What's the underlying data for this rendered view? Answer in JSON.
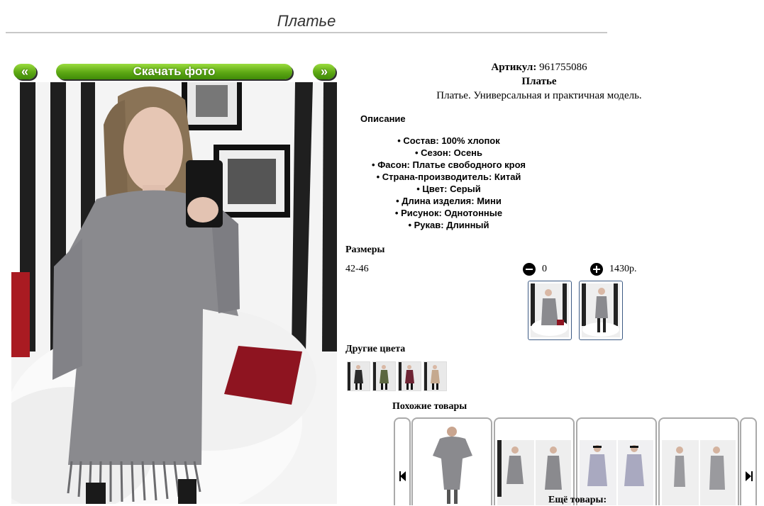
{
  "page": {
    "title": "Платье"
  },
  "nav": {
    "prev_label": "«",
    "download_label": "Скачать фото",
    "next_label": "»"
  },
  "product": {
    "article_label": "Артикул:",
    "article_value": "961755086",
    "name": "Платье",
    "description": "Платье. Универсальная и практичная модель."
  },
  "description_section": {
    "heading": "Описание",
    "attributes": [
      "Состав: 100% хлопок",
      "Сезон: Осень",
      "Фасон: Платье свободного кроя",
      "Страна-производитель: Китай",
      "Цвет: Серый",
      "Длина изделия: Мини",
      "Рисунок: Однотонные",
      "Рукав: Длинный"
    ]
  },
  "sizes": {
    "heading": "Размеры",
    "rows": [
      {
        "size": "42-46",
        "quantity": "0",
        "price": "1430р."
      }
    ]
  },
  "other_colors": {
    "heading": "Другие цвета",
    "swatches": [
      "black-dress",
      "olive-dress",
      "burgundy-dress",
      "beige-dress"
    ],
    "colors": [
      "#2b2b2b",
      "#5b6640",
      "#6e2434",
      "#c5a98f"
    ]
  },
  "similar": {
    "heading": "Похожие товары",
    "more_label": "Ещё товары:"
  },
  "colors": {
    "accent_green": "#5da814",
    "thumb_border": "#3d5b84",
    "dress_gray": "#8a8a8e"
  }
}
